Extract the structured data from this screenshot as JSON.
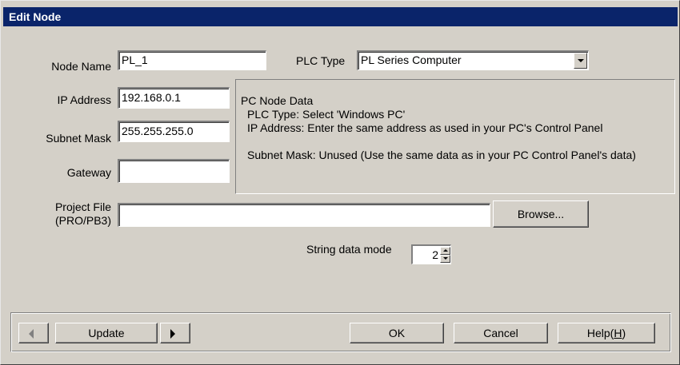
{
  "window": {
    "title": "Edit Node"
  },
  "form": {
    "node_name_label": "Node Name",
    "node_name_value": "PL_1",
    "plc_type_label": "PLC Type",
    "plc_type_value": "PL Series Computer",
    "ip_address_label": "IP Address",
    "ip_address_value": "192.168.0.1",
    "subnet_mask_label": "Subnet Mask",
    "subnet_mask_value": "255.255.255.0",
    "gateway_label": "Gateway",
    "gateway_value": "",
    "project_file_label_line1": "Project File",
    "project_file_label_line2": "(PRO/PB3)",
    "project_file_value": "",
    "browse_label": "Browse...",
    "string_data_mode_label": "String data mode",
    "string_data_mode_value": "2"
  },
  "info": {
    "heading": "PC Node Data",
    "line1": "PLC Type: Select 'Windows PC'",
    "line2": "IP Address: Enter the same address as used in your PC's Control Panel",
    "line3": "Subnet Mask: Unused (Use the same data as in your PC Control Panel's data)"
  },
  "footer": {
    "update_label": "Update",
    "ok_label": "OK",
    "cancel_label": "Cancel",
    "help_label_prefix": "Help(",
    "help_label_key": "H",
    "help_label_suffix": ")"
  },
  "icons": {
    "dropdown": "chevron-down-icon",
    "prev": "arrow-left-icon",
    "next": "arrow-right-icon",
    "spin_up": "spin-up-icon",
    "spin_down": "spin-down-icon"
  },
  "colors": {
    "titlebar": "#0a246a",
    "face": "#d4d0c8",
    "field": "#ffffff"
  }
}
